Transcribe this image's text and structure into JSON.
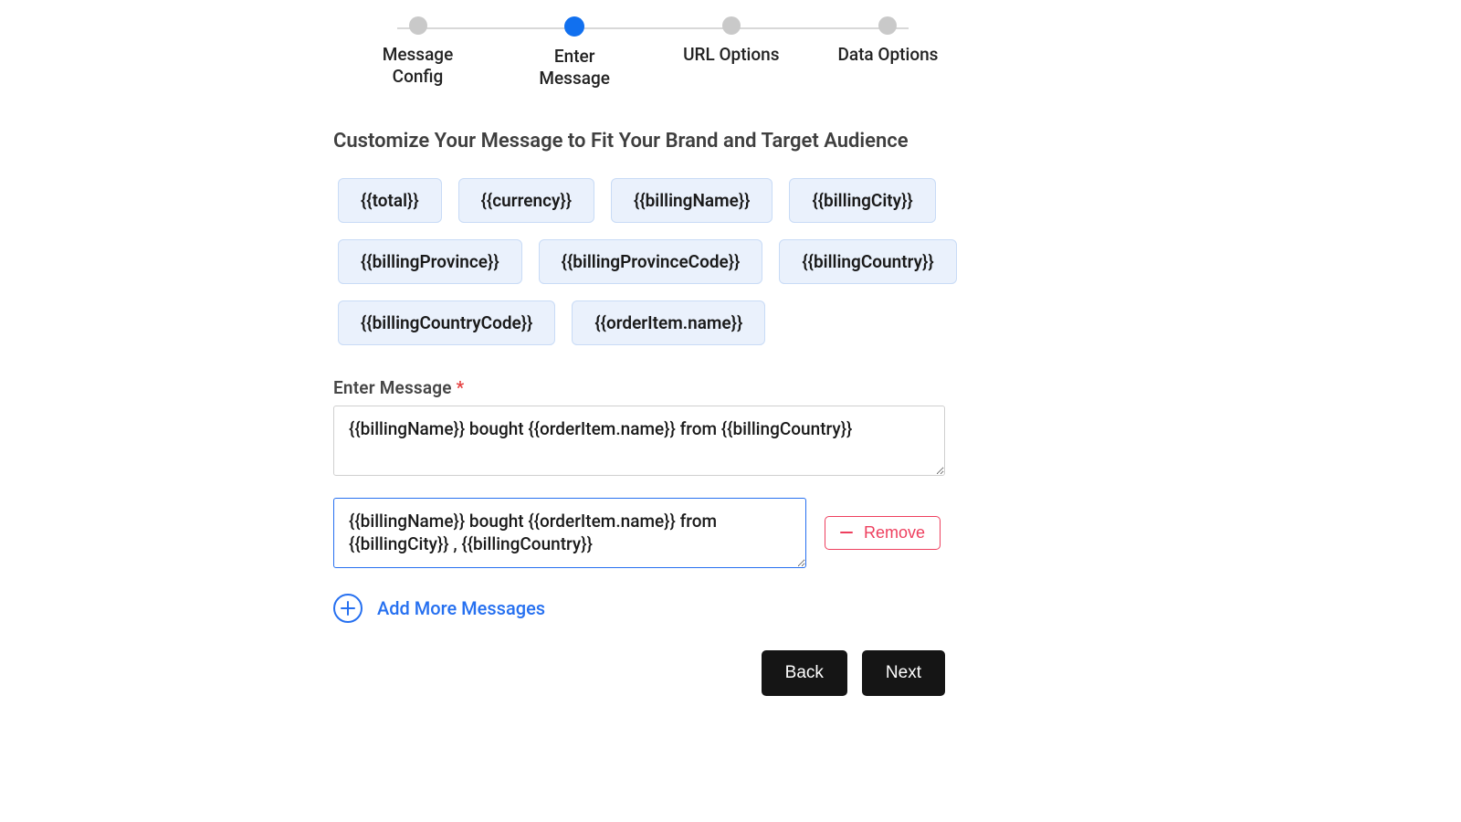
{
  "stepper": {
    "steps": [
      {
        "label": "Message Config",
        "active": false
      },
      {
        "label": "Enter Message",
        "active": true
      },
      {
        "label": "URL Options",
        "active": false
      },
      {
        "label": "Data Options",
        "active": false
      }
    ]
  },
  "heading": "Customize Your Message to Fit Your Brand and Target Audience",
  "chips": [
    "{{total}}",
    "{{currency}}",
    "{{billingName}}",
    "{{billingCity}}",
    "{{billingProvince}}",
    "{{billingProvinceCode}}",
    "{{billingCountry}}",
    "{{billingCountryCode}}",
    "{{orderItem.name}}"
  ],
  "field": {
    "label": "Enter Message",
    "required": "*"
  },
  "messages": [
    {
      "value": "{{billingName}} bought {{orderItem.name}} from {{billingCountry}}"
    },
    {
      "value": "{{billingName}} bought {{orderItem.name}} from {{billingCity}} , {{billingCountry}}"
    }
  ],
  "actions": {
    "remove": "Remove",
    "addMore": "Add More Messages",
    "back": "Back",
    "next": "Next"
  }
}
